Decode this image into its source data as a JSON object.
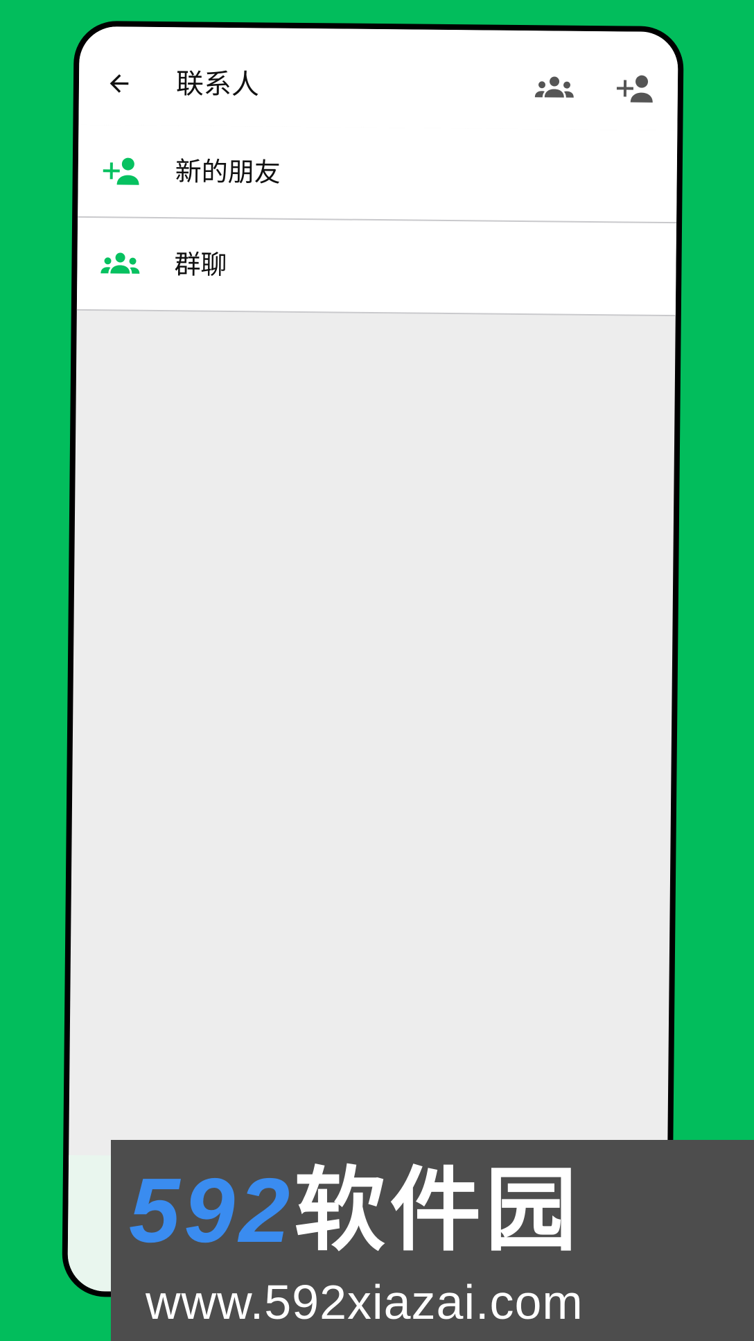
{
  "header": {
    "title": "联系人",
    "back_icon": "arrow-left-icon",
    "group_icon": "group-icon",
    "add_contact_icon": "person-add-icon"
  },
  "list": {
    "items": [
      {
        "label": "新的朋友",
        "icon": "person-add-icon"
      },
      {
        "label": "群聊",
        "icon": "group-icon"
      }
    ]
  },
  "watermark": {
    "number": "592",
    "text": "软件园",
    "url": "www.592xiazai.com"
  },
  "colors": {
    "background": "#02bd5c",
    "accent": "#07c160",
    "icon_gray": "#555555",
    "watermark_bg": "#4d4d4d",
    "watermark_blue": "#3a8cf0"
  }
}
